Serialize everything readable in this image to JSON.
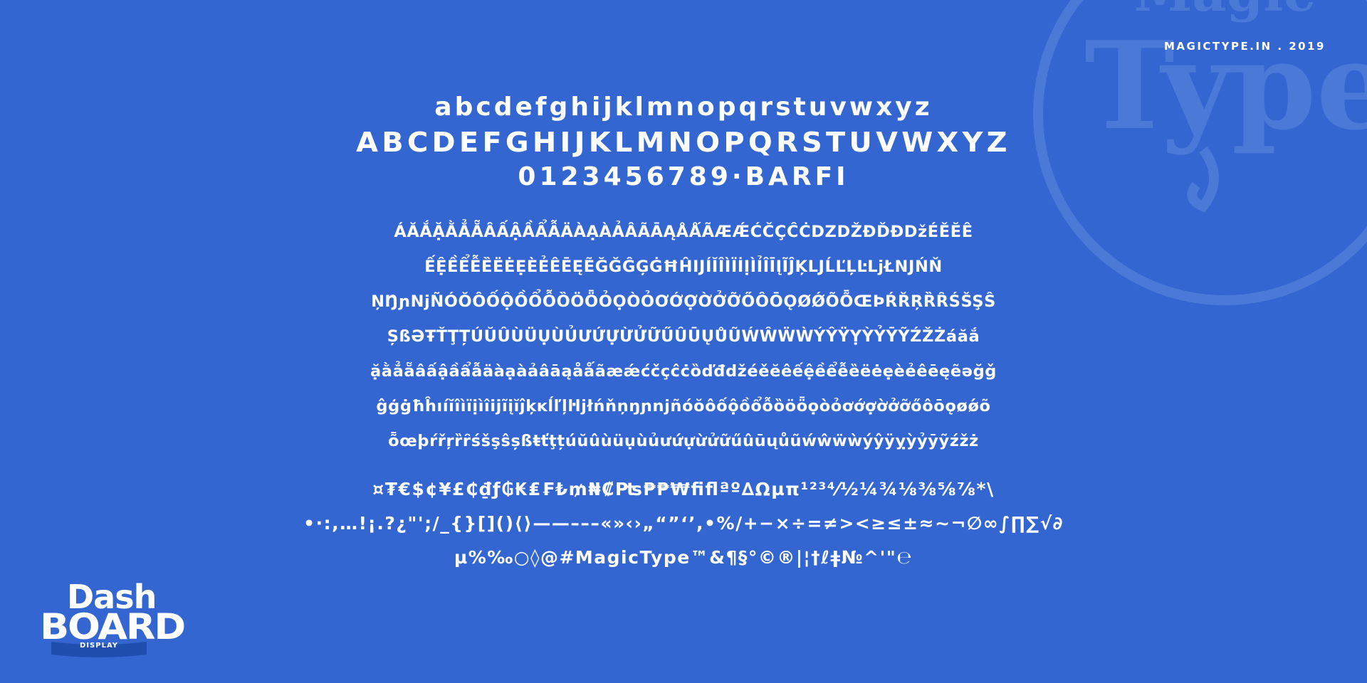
{
  "header": {
    "site_label": "MAGICTYPE.IN . 2019"
  },
  "watermark": {
    "text_top": "Magic",
    "text_main": "Type"
  },
  "specimen": {
    "lowercase": "abcdefghijklmnopqrstuvwxyz",
    "uppercase": "ABCDEFGHIJKLMNOPQRSTUVWXYZ",
    "digits": "0123456789·BARFI"
  },
  "glyphs": [
    "ÁĂẮẶẰẲẴÂẤẬẦẨẪÄÀẠÀẢÂÃĀĄÅǺÃÆǼĆČÇĈĊDZDŽĐĎĐDžÉĚĔÊ",
    "ẾỆỀỂỄȄËĖẸÈẺÊĒĘẼĞǦĜĢĠĦĤIJÍĬÎÌÏİỊÌỈÎĪĮĨĴĶLJĹĽĻĿLjŁNJŃŇ",
    "ŅŊɲNjÑÓŎÔỐỘỒỔỖȌÖȪỎỌÒỎƠỚỢỜỞỠŐÔŌǪØǾÕȬŒÞŔŘŖȐȒŚŠŞŜ",
    "ȘßƏŦŤŢȚÚŬÛÙÜỤÙỦƯỨỰỪỬỮŰÛŪŲŮŨẂŴẄẀÝŶŸỴỲỶȲỸŹŽŻáăắ",
    "ặằẳẵâấậầẩẫäàạàảâāąåǻãæǽćčçĉċȍďđdžéěĕêếệềểễȅëėẹèẻêēęẽəğǧ",
    "ĝģġħĥıíĭîìïịìîijĩįĭĵķĸĺľļŀljłńňņŋɲnjñóŏôốộồổỗȍöȫọòỏơớợờởỡőôōǫøǿõ",
    "ȭœþŕřŗȑȓśšşŝșßŧťţțúŭûùüụùủưứựừửữűûūųůũẃŵẅẁýŷÿỵỳỷȳỹźžż"
  ],
  "symbols": [
    "¤₮€$¢¥£₵₫ƒ₲₭₤₣₺₥₦₡₧₱₱₩ﬁﬂªº∆Ωµπ¹²³⁴⁄½¼¾⅛⅜⅝⅞*\\",
    "•·:,…!¡.?¿\"';/_{}[]()⟨⟩——–––«»‹›„“”‘’,•%/+−×÷=≠><≥≤±≈~¬∅∞∫∏∑√∂",
    "µ%‰○◊@#MagicType™&¶§°©®|¦†ℓǂ№^'\"℮"
  ],
  "logo": {
    "line1": "Dash",
    "line2": "BOARD",
    "line3": "DISPLAY"
  },
  "colors": {
    "background": "#3366d0",
    "foreground": "#ffffff",
    "watermark": "#4a7ad8",
    "ribbon": "#1f4fae"
  }
}
